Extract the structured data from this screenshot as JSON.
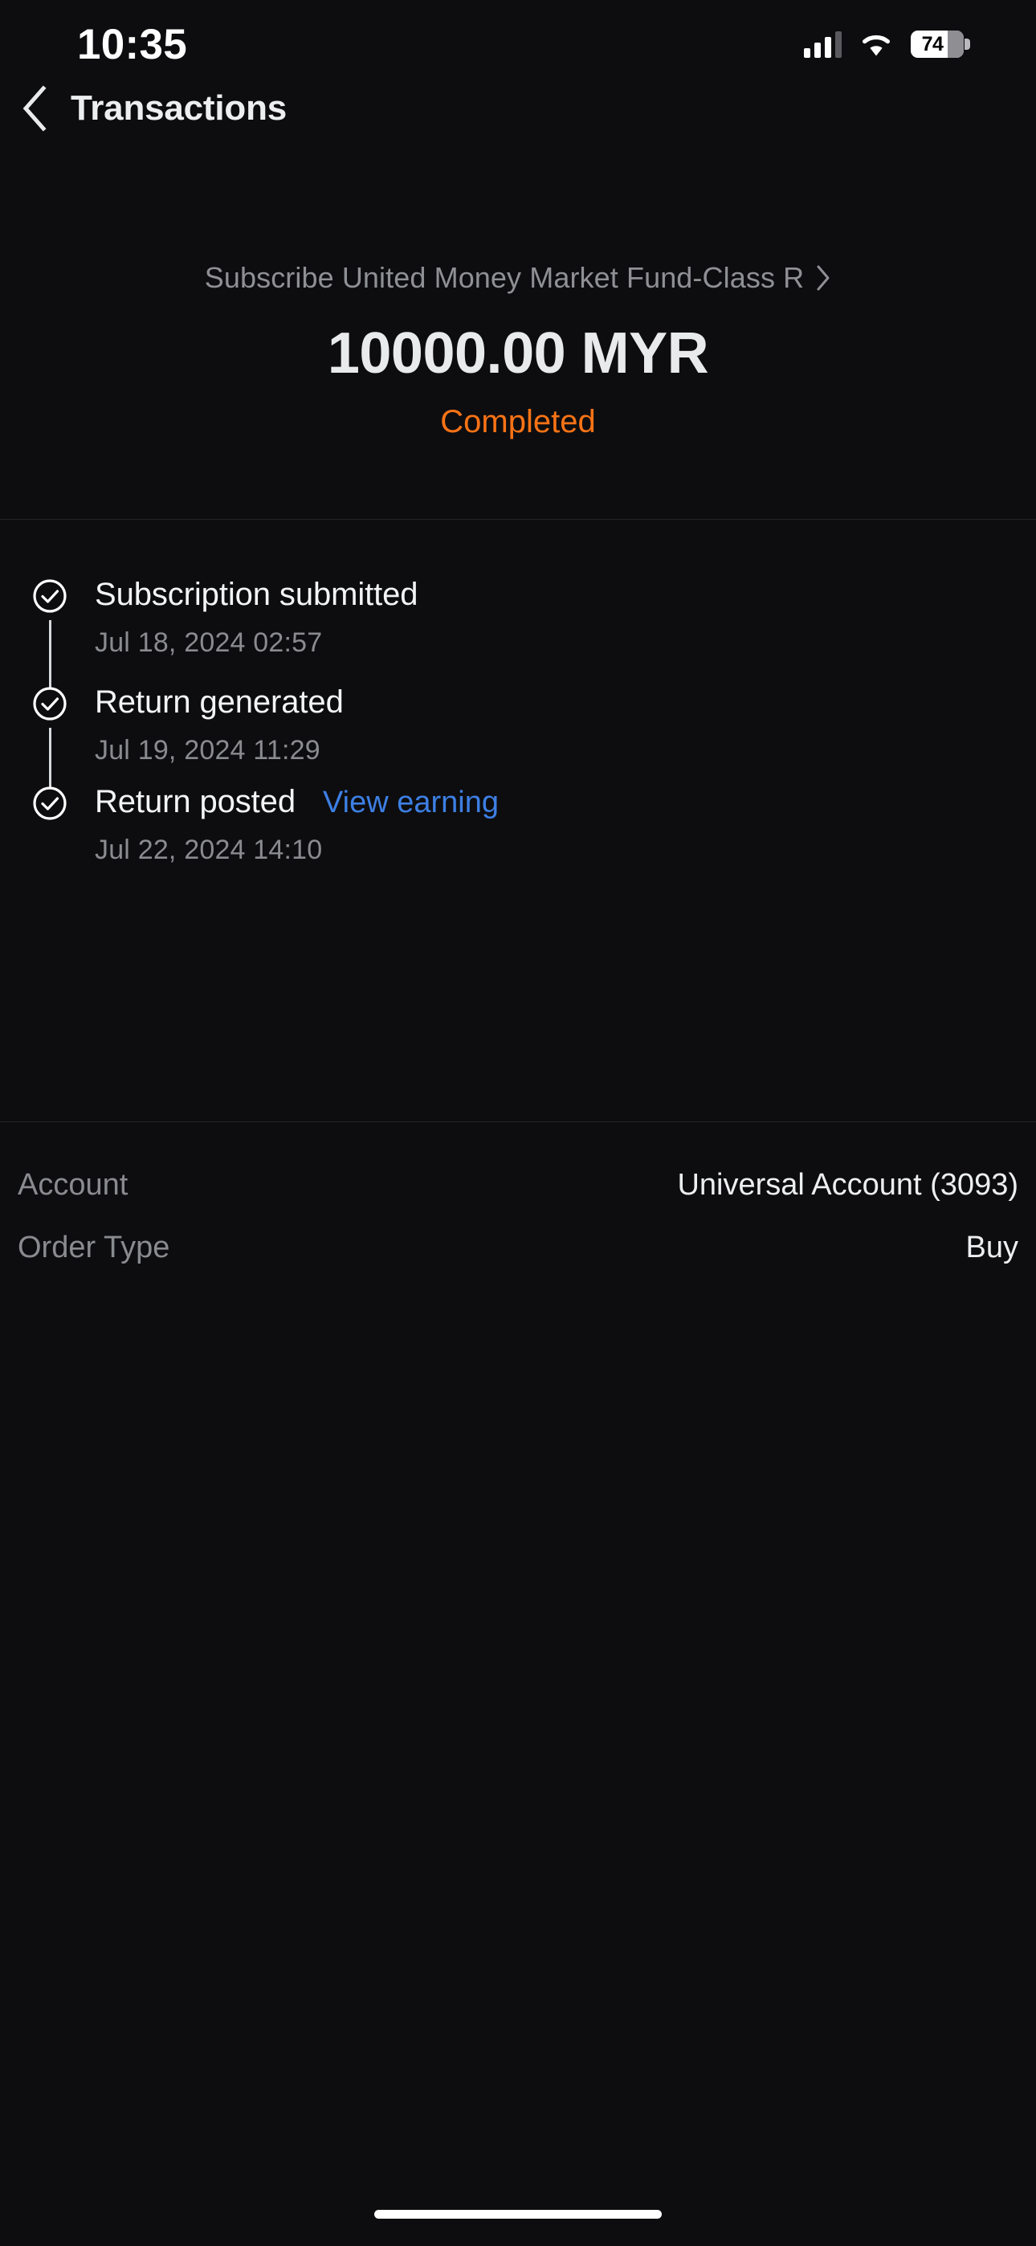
{
  "status_bar": {
    "time": "10:35",
    "battery_percent": "74",
    "signal_icon": "cellular-signal-icon",
    "wifi_icon": "wifi-icon",
    "battery_icon": "battery-icon"
  },
  "nav": {
    "back_icon": "chevron-left-icon",
    "title": "Transactions"
  },
  "summary": {
    "fund_name": "Subscribe United Money Market Fund-Class R",
    "fund_chevron_icon": "chevron-right-icon",
    "amount": "10000.00 MYR",
    "status": "Completed",
    "status_color": "#f97316"
  },
  "timeline": {
    "steps": [
      {
        "icon": "check-circle-icon",
        "title": "Subscription submitted",
        "time": "Jul 18, 2024 02:57",
        "link": ""
      },
      {
        "icon": "check-circle-icon",
        "title": "Return generated",
        "time": "Jul 19, 2024 11:29",
        "link": ""
      },
      {
        "icon": "check-circle-icon",
        "title": "Return posted",
        "time": "Jul 22, 2024 14:10",
        "link": "View earning",
        "link_color": "#3d7fe4"
      }
    ]
  },
  "details": {
    "rows": [
      {
        "label": "Account",
        "value": "Universal Account (3093)"
      },
      {
        "label": "Order Type",
        "value": "Buy"
      }
    ]
  }
}
